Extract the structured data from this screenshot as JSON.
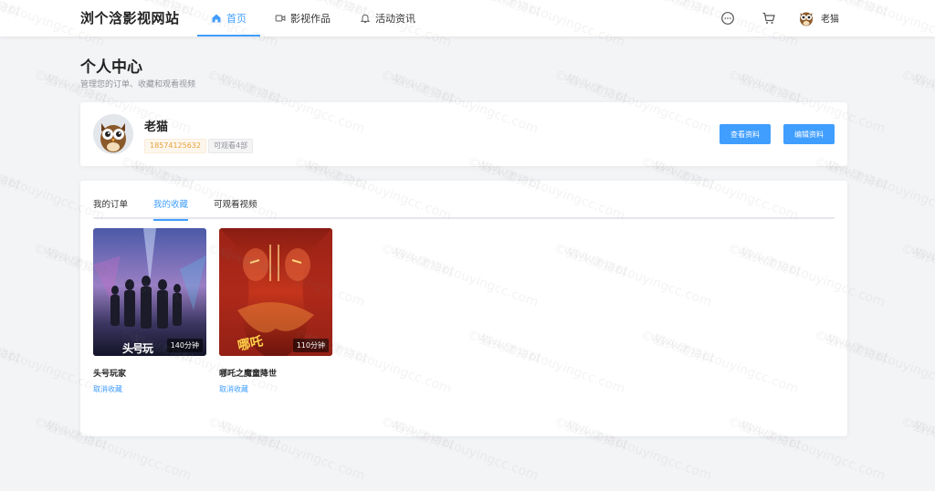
{
  "header": {
    "brand": "浏个浛影视网站",
    "nav": [
      {
        "label": "首页",
        "icon": "home-icon",
        "active": true
      },
      {
        "label": "影视作品",
        "icon": "video-camera-icon",
        "active": false
      },
      {
        "label": "活动资讯",
        "icon": "bell-icon",
        "active": false
      }
    ],
    "user_name": "老猫"
  },
  "page": {
    "title": "个人中心",
    "subtitle": "管理您的订单、收藏和观看视频"
  },
  "profile": {
    "name": "老猫",
    "phone": "18574125632",
    "watch_count": "可观看4部",
    "view_button": "查看资料",
    "edit_button": "编辑资料"
  },
  "tabs": [
    {
      "label": "我的订单",
      "active": false
    },
    {
      "label": "我的收藏",
      "active": true
    },
    {
      "label": "可观看视频",
      "active": false
    }
  ],
  "movies": [
    {
      "title": "头号玩家",
      "duration": "140分钟",
      "action": "取消收藏",
      "poster_text": "头号玩"
    },
    {
      "title": "哪吒之魔童降世",
      "duration": "110分钟",
      "action": "取消收藏",
      "poster_text": "哪吒"
    }
  ],
  "colors": {
    "accent": "#409eff",
    "phone_tag": "#e6a23c"
  },
  "watermark": {
    "line1": "©猫头鹰资料",
    "line2": "www.maotouyingcc.com"
  }
}
